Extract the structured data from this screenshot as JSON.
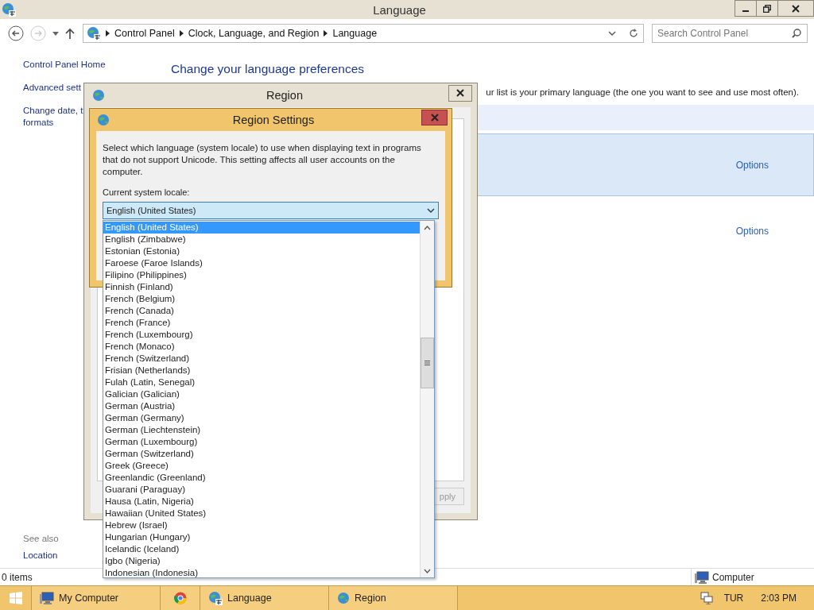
{
  "window": {
    "title": "Language"
  },
  "address_bar": {
    "breadcrumbs": [
      "Control Panel",
      "Clock, Language, and Region",
      "Language"
    ],
    "search": {
      "placeholder": "Search Control Panel"
    }
  },
  "sidebar": {
    "links": [
      {
        "lines": [
          "Control Panel Home"
        ]
      },
      {
        "lines": [
          "Advanced sett"
        ]
      },
      {
        "lines": [
          "Change date, t",
          "formats"
        ]
      }
    ],
    "see_also": {
      "label": "See also",
      "links": [
        "Location"
      ]
    }
  },
  "main": {
    "heading": "Change your language preferences",
    "description": "ur list is your primary language (the one you want to see and use most often).",
    "languages": [
      {
        "selected": true,
        "options": "Options"
      },
      {
        "selected": false,
        "options": "Options"
      }
    ]
  },
  "region_dialog": {
    "title": "Region",
    "apply_button": "pply"
  },
  "region_settings": {
    "title": "Region Settings",
    "description": "Select which language (system locale) to use when displaying text in programs that do not support Unicode. This setting affects all user accounts on the computer.",
    "locale_label": "Current system locale:",
    "locale_value": "English (United States)",
    "dropdown_items": [
      {
        "label": "English (United States)",
        "selected": true
      },
      {
        "label": "English (Zimbabwe)",
        "selected": false
      },
      {
        "label": "Estonian (Estonia)",
        "selected": false
      },
      {
        "label": "Faroese (Faroe Islands)",
        "selected": false
      },
      {
        "label": "Filipino (Philippines)",
        "selected": false
      },
      {
        "label": "Finnish (Finland)",
        "selected": false
      },
      {
        "label": "French (Belgium)",
        "selected": false
      },
      {
        "label": "French (Canada)",
        "selected": false
      },
      {
        "label": "French (France)",
        "selected": false
      },
      {
        "label": "French (Luxembourg)",
        "selected": false
      },
      {
        "label": "French (Monaco)",
        "selected": false
      },
      {
        "label": "French (Switzerland)",
        "selected": false
      },
      {
        "label": "Frisian (Netherlands)",
        "selected": false
      },
      {
        "label": "Fulah (Latin, Senegal)",
        "selected": false
      },
      {
        "label": "Galician (Galician)",
        "selected": false
      },
      {
        "label": "German (Austria)",
        "selected": false
      },
      {
        "label": "German (Germany)",
        "selected": false
      },
      {
        "label": "German (Liechtenstein)",
        "selected": false
      },
      {
        "label": "German (Luxembourg)",
        "selected": false
      },
      {
        "label": "German (Switzerland)",
        "selected": false
      },
      {
        "label": "Greek (Greece)",
        "selected": false
      },
      {
        "label": "Greenlandic (Greenland)",
        "selected": false
      },
      {
        "label": "Guarani (Paraguay)",
        "selected": false
      },
      {
        "label": "Hausa (Latin, Nigeria)",
        "selected": false
      },
      {
        "label": "Hawaiian (United States)",
        "selected": false
      },
      {
        "label": "Hebrew (Israel)",
        "selected": false
      },
      {
        "label": "Hungarian (Hungary)",
        "selected": false
      },
      {
        "label": "Icelandic (Iceland)",
        "selected": false
      },
      {
        "label": "Igbo (Nigeria)",
        "selected": false
      },
      {
        "label": "Indonesian (Indonesia)",
        "selected": false
      }
    ]
  },
  "status_bar": {
    "items": "0 items",
    "computer": "Computer"
  },
  "taskbar": {
    "buttons": [
      {
        "kind": "computer",
        "label": "My Computer"
      },
      {
        "kind": "browser"
      },
      {
        "kind": "language",
        "label": "Language"
      },
      {
        "kind": "region",
        "label": "Region"
      }
    ],
    "tray": {
      "language": "TUR",
      "time": "2:03 PM"
    }
  }
}
